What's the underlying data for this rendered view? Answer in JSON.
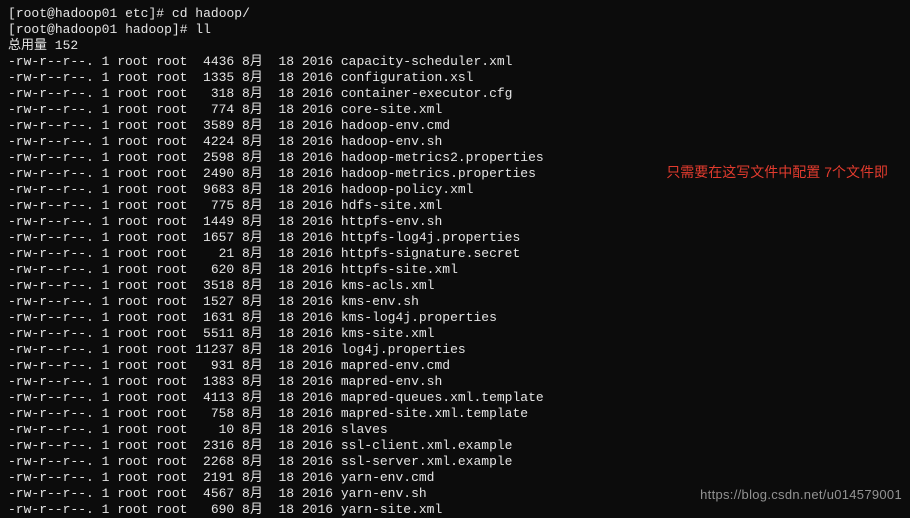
{
  "prompt1": {
    "user": "root",
    "host": "hadoop01",
    "path": "etc",
    "cmd": "cd hadoop/"
  },
  "prompt2": {
    "user": "root",
    "host": "hadoop01",
    "path": "hadoop",
    "cmd": "ll"
  },
  "total_label": "总用量 152",
  "annotation": "只需要在这写文件中配置 7个文件即",
  "watermark": "https://blog.csdn.net/u014579001",
  "cols": {
    "perm": "-rw-r--r--.",
    "links": "1",
    "owner": "root",
    "group": "root",
    "month": "8月",
    "day": "18",
    "year": "2016"
  },
  "files": [
    {
      "size": "4436",
      "name": "capacity-scheduler.xml"
    },
    {
      "size": "1335",
      "name": "configuration.xsl"
    },
    {
      "size": "318",
      "name": "container-executor.cfg"
    },
    {
      "size": "774",
      "name": "core-site.xml"
    },
    {
      "size": "3589",
      "name": "hadoop-env.cmd"
    },
    {
      "size": "4224",
      "name": "hadoop-env.sh"
    },
    {
      "size": "2598",
      "name": "hadoop-metrics2.properties"
    },
    {
      "size": "2490",
      "name": "hadoop-metrics.properties"
    },
    {
      "size": "9683",
      "name": "hadoop-policy.xml"
    },
    {
      "size": "775",
      "name": "hdfs-site.xml"
    },
    {
      "size": "1449",
      "name": "httpfs-env.sh"
    },
    {
      "size": "1657",
      "name": "httpfs-log4j.properties"
    },
    {
      "size": "21",
      "name": "httpfs-signature.secret"
    },
    {
      "size": "620",
      "name": "httpfs-site.xml"
    },
    {
      "size": "3518",
      "name": "kms-acls.xml"
    },
    {
      "size": "1527",
      "name": "kms-env.sh"
    },
    {
      "size": "1631",
      "name": "kms-log4j.properties"
    },
    {
      "size": "5511",
      "name": "kms-site.xml"
    },
    {
      "size": "11237",
      "name": "log4j.properties"
    },
    {
      "size": "931",
      "name": "mapred-env.cmd"
    },
    {
      "size": "1383",
      "name": "mapred-env.sh"
    },
    {
      "size": "4113",
      "name": "mapred-queues.xml.template"
    },
    {
      "size": "758",
      "name": "mapred-site.xml.template"
    },
    {
      "size": "10",
      "name": "slaves"
    },
    {
      "size": "2316",
      "name": "ssl-client.xml.example"
    },
    {
      "size": "2268",
      "name": "ssl-server.xml.example"
    },
    {
      "size": "2191",
      "name": "yarn-env.cmd"
    },
    {
      "size": "4567",
      "name": "yarn-env.sh"
    },
    {
      "size": "690",
      "name": "yarn-site.xml"
    }
  ]
}
